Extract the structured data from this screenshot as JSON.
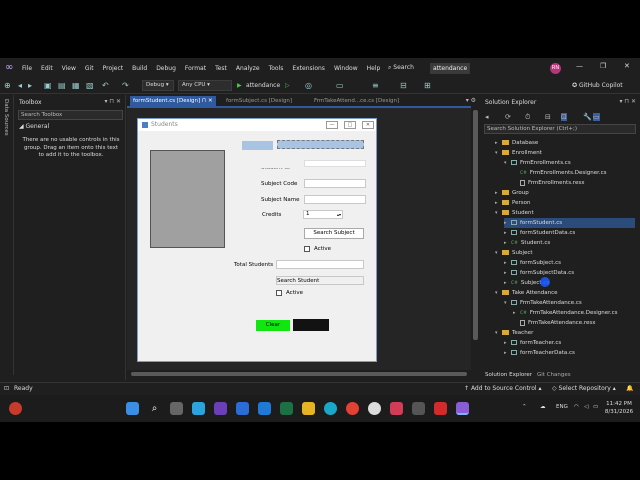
{
  "menu": [
    "File",
    "Edit",
    "View",
    "Git",
    "Project",
    "Build",
    "Debug",
    "Format",
    "Test",
    "Analyze",
    "Tools",
    "Extensions",
    "Window",
    "Help"
  ],
  "search_label": "Search",
  "solution_name": "attendance",
  "avatar_initials": "RN",
  "toolbar": {
    "config": "Debug",
    "platform": "Any CPU",
    "start_target": "attendance",
    "copilot": "GitHub Copilot"
  },
  "left_strip_label": "Data Sources",
  "toolbox": {
    "title": "Toolbox",
    "search_placeholder": "Search Toolbox",
    "group": "General",
    "empty_message": "There are no usable controls in this group. Drag an item onto this text to add it to the toolbox."
  },
  "tabs": [
    {
      "label": "formStudent.cs [Design]",
      "active": true
    },
    {
      "label": "formSubject.cs [Design]",
      "active": false
    },
    {
      "label": "FrmTakeAttend...ce.cs [Design]",
      "active": false
    }
  ],
  "form": {
    "title": "Students",
    "labels": {
      "student_id": "Student ID",
      "subject_code": "Subject Code",
      "subject_name": "Subject Name",
      "credits": "Credits",
      "total_students": "Total Students",
      "search_student": "Search Student"
    },
    "credits_value": "1",
    "search_subject_button": "Search Subject",
    "active_label_1": "Active",
    "active_label_2": "Active",
    "clear_button": "Clear"
  },
  "solution_explorer": {
    "title": "Solution Explorer",
    "search_placeholder": "Search Solution Explorer (Ctrl+;)",
    "tree": [
      {
        "label": "Database",
        "type": "folder",
        "indent": 0,
        "arrow": "▸"
      },
      {
        "label": "Enrollment",
        "type": "folder",
        "indent": 0,
        "arrow": "▾"
      },
      {
        "label": "FrmEnrollments.cs",
        "type": "form",
        "indent": 1,
        "arrow": "▾"
      },
      {
        "label": "FrmEnrollments.Designer.cs",
        "type": "cs",
        "indent": 2,
        "arrow": ""
      },
      {
        "label": "FrmEnrollments.resx",
        "type": "resx",
        "indent": 2,
        "arrow": ""
      },
      {
        "label": "Group",
        "type": "folder",
        "indent": 0,
        "arrow": "▸"
      },
      {
        "label": "Person",
        "type": "folder",
        "indent": 0,
        "arrow": "▸"
      },
      {
        "label": "Student",
        "type": "folder",
        "indent": 0,
        "arrow": "▾"
      },
      {
        "label": "formStudent.cs",
        "type": "form",
        "indent": 1,
        "arrow": "▸",
        "selected": true
      },
      {
        "label": "formStudentData.cs",
        "type": "form",
        "indent": 1,
        "arrow": "▸"
      },
      {
        "label": "Student.cs",
        "type": "cs",
        "indent": 1,
        "arrow": "▸"
      },
      {
        "label": "Subject",
        "type": "folder",
        "indent": 0,
        "arrow": "▾"
      },
      {
        "label": "formSubject.cs",
        "type": "form",
        "indent": 1,
        "arrow": "▸"
      },
      {
        "label": "formSubjectData.cs",
        "type": "form",
        "indent": 1,
        "arrow": "▸"
      },
      {
        "label": "Subject.cs",
        "type": "cs",
        "indent": 1,
        "arrow": "▸"
      },
      {
        "label": "Take Attendance",
        "type": "folder",
        "indent": 0,
        "arrow": "▾"
      },
      {
        "label": "FrmTakeAttendance.cs",
        "type": "form",
        "indent": 1,
        "arrow": "▾"
      },
      {
        "label": "FrmTakeAttendance.Designer.cs",
        "type": "cs",
        "indent": 2,
        "arrow": "▸"
      },
      {
        "label": "FrmTakeAttendance.resx",
        "type": "resx",
        "indent": 2,
        "arrow": ""
      },
      {
        "label": "Teacher",
        "type": "folder",
        "indent": 0,
        "arrow": "▾"
      },
      {
        "label": "formTeacher.cs",
        "type": "form",
        "indent": 1,
        "arrow": "▸"
      },
      {
        "label": "formTeacherData.cs",
        "type": "form",
        "indent": 1,
        "arrow": "▸"
      }
    ],
    "bottom_tabs": [
      "Solution Explorer",
      "Git Changes"
    ]
  },
  "status": {
    "ready": "Ready",
    "source_control": "Add to Source Control",
    "repository": "Select Repository"
  },
  "taskbar": {
    "language": "ENG",
    "time": "11:42 PM",
    "date": "8/31/2026"
  },
  "colors": {
    "accent": "#2f5aa0",
    "clear_button": "#11e611"
  }
}
